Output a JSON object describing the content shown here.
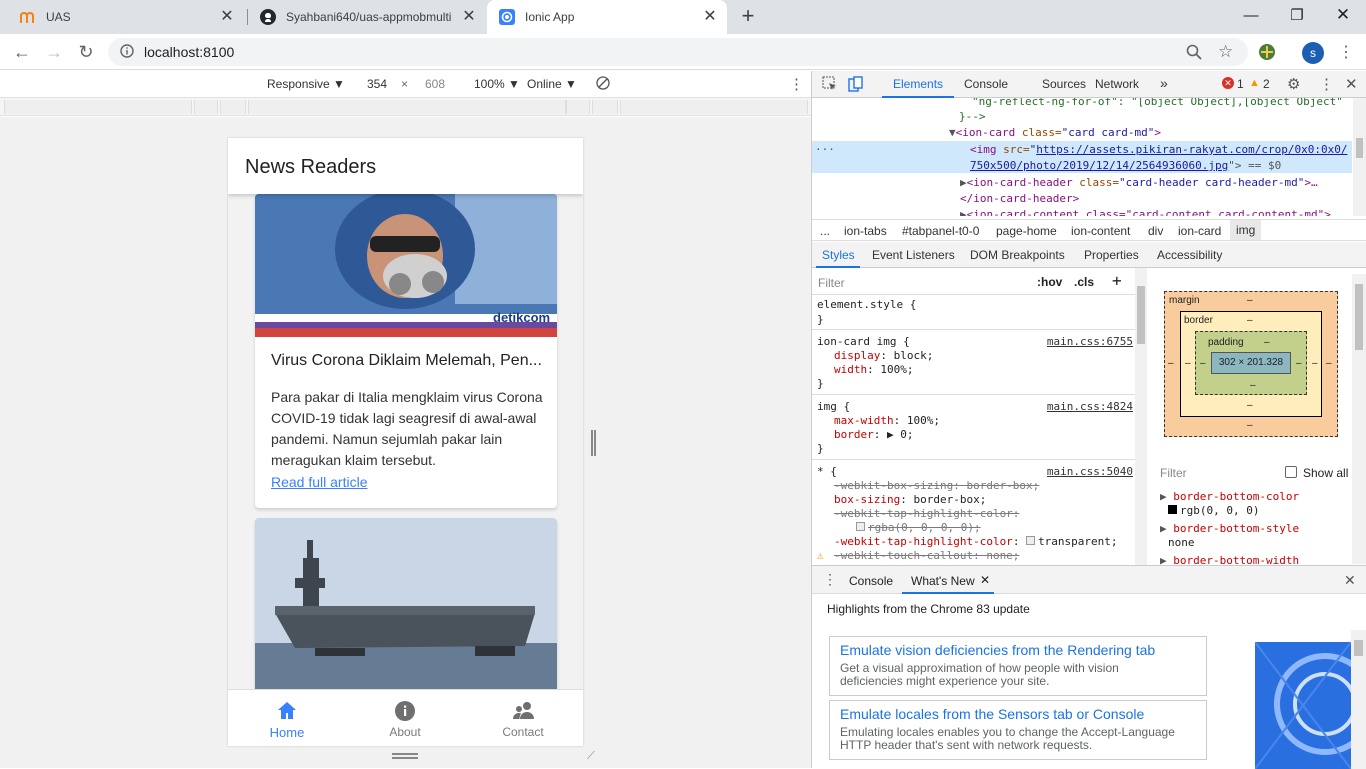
{
  "browser": {
    "tabs": [
      {
        "title": "UAS",
        "icon": "moodle-icon"
      },
      {
        "title": "Syahbani640/uas-appmobmulti",
        "icon": "github-icon"
      },
      {
        "title": "Ionic App",
        "icon": "ionic-icon"
      }
    ],
    "url": "localhost:8100",
    "profile_initial": "s"
  },
  "device_toolbar": {
    "mode": "Responsive ▼",
    "width": "354",
    "times": "×",
    "height": "608",
    "zoom": "100% ▼",
    "network": "Online ▼"
  },
  "app": {
    "title": "News Readers",
    "cards": [
      {
        "image_brand": "detikcom",
        "title": "Virus Corona Diklaim Melemah, Pen...",
        "body": "Para pakar di Italia mengklaim virus Corona COVID-19 tidak lagi seagresif di awal-awal pandemi. Namun sejumlah pakar lain meragukan klaim tersebut.",
        "link": "Read full article"
      }
    ],
    "tabs": [
      {
        "label": "Home",
        "icon": "home-icon",
        "selected": true
      },
      {
        "label": "About",
        "icon": "info-icon",
        "selected": false
      },
      {
        "label": "Contact",
        "icon": "people-icon",
        "selected": false
      }
    ],
    "accent": "#3880ff"
  },
  "devtools": {
    "tabs": [
      "Elements",
      "Console",
      "Sources",
      "Network",
      "»"
    ],
    "errors": "1",
    "warnings": "2",
    "tree": {
      "line1": "\"ng-reflect-ng-for-of\": \"[object Object],[object Object\"",
      "line2": "}-->",
      "line3_tag": "<ion-card ",
      "line3_attr": "class=",
      "line3_val": "\"card card-md\"",
      "line3_end": ">",
      "img_tag": "<img ",
      "img_attr": "src=",
      "img_src1": "https://assets.pikiran-rakyat.com/crop/0x0:0x0/",
      "img_src2": "750x500/photo/2019/12/14/2564936060.jpg",
      "img_end": "\"> == $0",
      "hdr_tag": "<ion-card-header ",
      "hdr_attr": "class=",
      "hdr_val": "\"card-header card-header-md\"",
      "hdr_end": ">…",
      "hdr_close": "</ion-card-header>",
      "cnt_line": "<ion-card-content class=\"card-content card-content-md\">"
    },
    "breadcrumbs": [
      "...",
      "ion-tabs",
      "#tabpanel-t0-0",
      "page-home",
      "ion-content",
      "div",
      "ion-card",
      "img"
    ],
    "subtabs": [
      "Styles",
      "Event Listeners",
      "DOM Breakpoints",
      "Properties",
      "Accessibility"
    ],
    "filter_placeholder": "Filter",
    "hov": ":hov",
    "cls": ".cls",
    "styles": {
      "element_style": "element.style {",
      "close": "}",
      "rule1_sel": "ion-card img {",
      "rule1_src": "main.css:6755",
      "rule1_p1": "display",
      "rule1_v1": "block;",
      "rule1_p2": "width",
      "rule1_v2": "100%;",
      "rule2_sel": "img {",
      "rule2_src": "main.css:4824",
      "rule2_p1": "max-width",
      "rule2_v1": "100%;",
      "rule2_p2": "border",
      "rule2_v2": "0;",
      "rule3_sel": "* {",
      "rule3_src": "main.css:5040",
      "rule3_l1": "-webkit-box-sizing: border-box;",
      "rule3_p2": "box-sizing",
      "rule3_v2": "border-box;",
      "rule3_l3": "-webkit-tap-highlight-color:",
      "rule3_l4": "rgba(0, 0, 0, 0);",
      "rule3_p5": "-webkit-tap-highlight-color",
      "rule3_v5": "transparent;",
      "rule3_l6": "-webkit-touch-callout: none;"
    },
    "boxmodel": {
      "margin": "margin",
      "border": "border",
      "padding": "padding",
      "dash": "–",
      "content": "302 × 201.328"
    },
    "computed": {
      "filter": "Filter",
      "show_all": "Show all",
      "p1": "border-bottom-color",
      "v1": "rgb(0, 0, 0)",
      "p2": "border-bottom-style",
      "v2": "none",
      "p3": "border-bottom-width"
    },
    "drawer": {
      "tabs": [
        "Console",
        "What's New"
      ],
      "highlight": "Highlights from the Chrome 83 update",
      "items": [
        {
          "title": "Emulate vision deficiencies from the Rendering tab",
          "desc": "Get a visual approximation of how people with vision deficiencies might experience your site."
        },
        {
          "title": "Emulate locales from the Sensors tab or Console",
          "desc": "Emulating locales enables you to change the Accept-Language HTTP header that's sent with network requests."
        }
      ]
    }
  }
}
